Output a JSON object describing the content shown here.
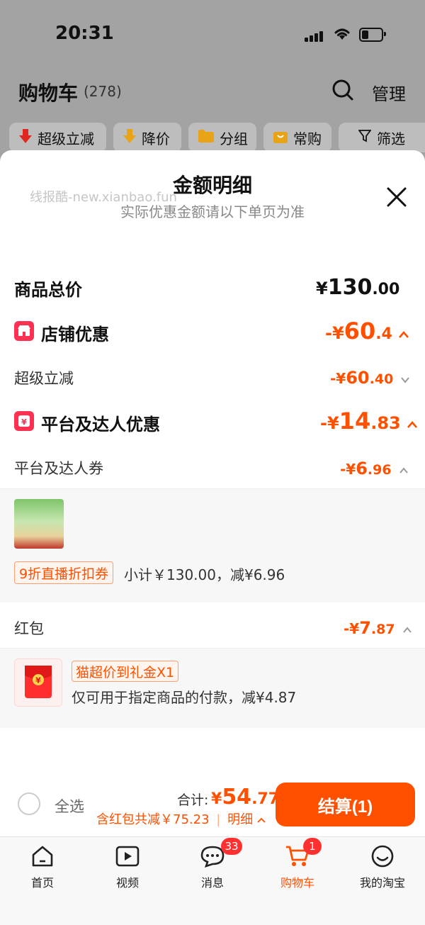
{
  "status_bar": {
    "time": "20:31"
  },
  "header": {
    "title": "购物车",
    "count": "(278)",
    "manage_label": "管理"
  },
  "filter_chips": [
    {
      "label": "超级立减",
      "icon": "arrow-down-icon"
    },
    {
      "label": "降价",
      "icon": "price-drop-icon"
    },
    {
      "label": "分组",
      "icon": "folder-icon"
    },
    {
      "label": "常购",
      "icon": "bag-icon"
    },
    {
      "label": "筛选",
      "icon": "filter-icon"
    }
  ],
  "sheet": {
    "title": "金额明细",
    "subtitle": "实际优惠金额请以下单页为准",
    "watermark": "线报酷-new.xianbao.fun"
  },
  "rows": {
    "goods_total": {
      "label": "商品总价",
      "currency": "¥",
      "int": "130",
      "dec": ".00"
    },
    "store_discount": {
      "label": "店铺优惠",
      "prefix": "-¥",
      "int": "60",
      "dec": ".4"
    },
    "super_cut": {
      "label": "超级立减",
      "prefix": "-¥",
      "int": "60",
      "dec": ".40"
    },
    "platform_discount": {
      "label": "平台及达人优惠",
      "prefix": "-¥",
      "int": "14",
      "dec": ".83"
    },
    "platform_coupon": {
      "label": "平台及达人券",
      "prefix": "-¥",
      "int": "6",
      "dec": ".96"
    },
    "red_packet": {
      "label": "红包",
      "prefix": "-¥",
      "int": "7",
      "dec": ".87"
    }
  },
  "coupon_detail": {
    "tag": "9折直播折扣券",
    "subtotal_text": "小计￥130.00，减¥6.96"
  },
  "red_packet_detail": {
    "tag": "猫超价到礼金X1",
    "desc": "仅可用于指定商品的付款，减¥4.87"
  },
  "checkout": {
    "select_all": "全选",
    "total_label": "合计:",
    "total_currency": "¥",
    "total_int": "54",
    "total_dec": ".77",
    "discount_text": "含红包共减￥75.23",
    "detail_label": "明细",
    "button_label": "结算(1)"
  },
  "tabbar": [
    {
      "label": "首页",
      "icon": "home-icon"
    },
    {
      "label": "视频",
      "icon": "video-icon"
    },
    {
      "label": "消息",
      "icon": "message-icon",
      "badge": "33"
    },
    {
      "label": "购物车",
      "icon": "cart-icon",
      "badge": "1",
      "active": true
    },
    {
      "label": "我的淘宝",
      "icon": "profile-icon"
    }
  ],
  "colors": {
    "accent": "#ff5000",
    "badge_red": "#ff3152",
    "active_tab": "#ff5000"
  }
}
